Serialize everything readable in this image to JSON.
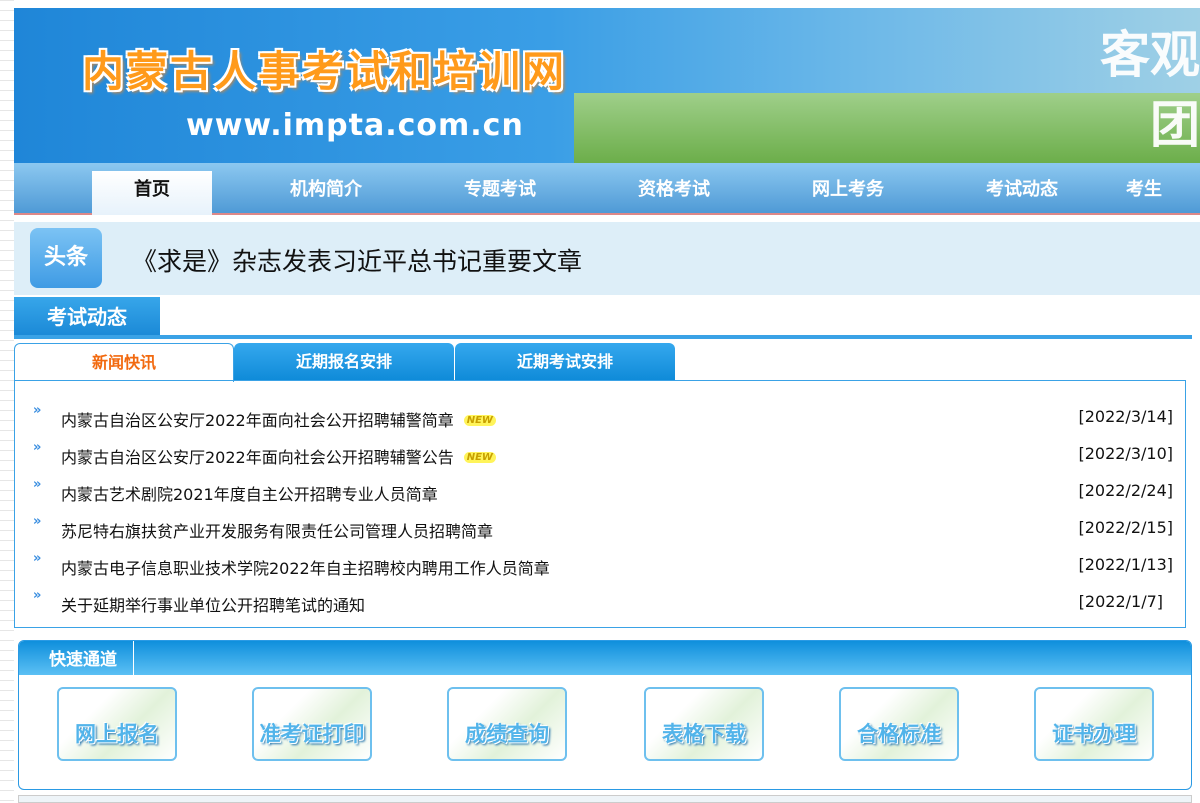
{
  "banner": {
    "title": "内蒙古人事考试和培训网",
    "url": "www.impta.com.cn",
    "slogan": "客观 团"
  },
  "nav": [
    "首页",
    "机构简介",
    "专题考试",
    "资格考试",
    "网上考务",
    "考试动态",
    "考生"
  ],
  "headline": {
    "tag": "头条",
    "text": "《求是》杂志发表习近平总书记重要文章"
  },
  "section": {
    "title": "考试动态",
    "tabs": [
      "新闻快讯",
      "近期报名安排",
      "近期考试安排"
    ]
  },
  "news": [
    {
      "title": "内蒙古自治区公安厅2022年面向社会公开招聘辅警简章",
      "date": "[2022/3/14]",
      "new": "NEW"
    },
    {
      "title": "内蒙古自治区公安厅2022年面向社会公开招聘辅警公告",
      "date": "[2022/3/10]",
      "new": "NEW"
    },
    {
      "title": "内蒙古艺术剧院2021年度自主公开招聘专业人员简章",
      "date": "[2022/2/24]"
    },
    {
      "title": "苏尼特右旗扶贫产业开发服务有限责任公司管理人员招聘简章",
      "date": "[2022/2/15]"
    },
    {
      "title": "内蒙古电子信息职业技术学院2022年自主招聘校内聘用工作人员简章",
      "date": "[2022/1/13]"
    },
    {
      "title": "关于延期举行事业单位公开招聘笔试的通知",
      "date": "[2022/1/7]"
    }
  ],
  "quick": {
    "title": "快速通道",
    "items": [
      "网上报名",
      "准考证打印",
      "成绩查询",
      "表格下载",
      "合格标准",
      "证书办理"
    ]
  }
}
